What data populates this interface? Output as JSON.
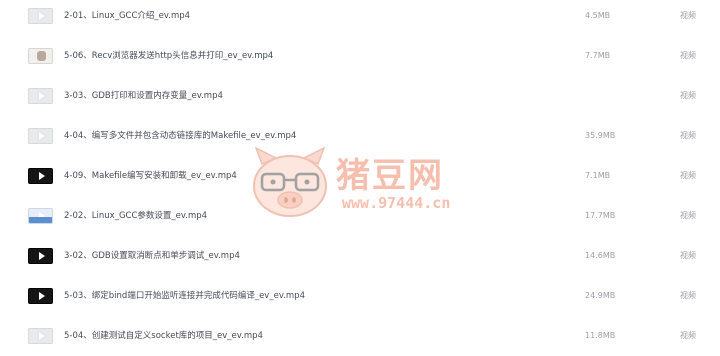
{
  "files": [
    {
      "name": "2-01、Linux_GCC介绍_ev.mp4",
      "size": "4.5MB",
      "type": "视频",
      "thumb": "light"
    },
    {
      "name": "5-06、Recv浏览器发送http头信息并打印_ev_ev.mp4",
      "size": "7.7MB",
      "type": "视频",
      "thumb": "photo"
    },
    {
      "name": "3-03、GDB打印和设置内存变量_ev.mp4",
      "size": "",
      "type": "视频",
      "thumb": "light"
    },
    {
      "name": "4-04、编写多文件并包含动态链接库的Makefile_ev_ev.mp4",
      "size": "35.9MB",
      "type": "视频",
      "thumb": "light"
    },
    {
      "name": "4-09、Makefile编写安装和卸载_ev_ev.mp4",
      "size": "7.1MB",
      "type": "视频",
      "thumb": "dark"
    },
    {
      "name": "2-02、Linux_GCC参数设置_ev.mp4",
      "size": "17.7MB",
      "type": "视频",
      "thumb": "blue"
    },
    {
      "name": "3-02、GDB设置取消断点和单步调试_ev.mp4",
      "size": "14.6MB",
      "type": "视频",
      "thumb": "dark"
    },
    {
      "name": "5-03、绑定bind端口开始监听连接并完成代码编译_ev_ev.mp4",
      "size": "24.9MB",
      "type": "视频",
      "thumb": "dark"
    },
    {
      "name": "5-04、创建测试自定义socket库的项目_ev_ev.mp4",
      "size": "11.8MB",
      "type": "视频",
      "thumb": "light"
    }
  ],
  "watermark": {
    "brand": "猪豆网",
    "url": "www.97444.cn"
  },
  "colors": {
    "text": "#444a55",
    "muted": "#9aa0a8",
    "watermark": "#f08a6a"
  }
}
